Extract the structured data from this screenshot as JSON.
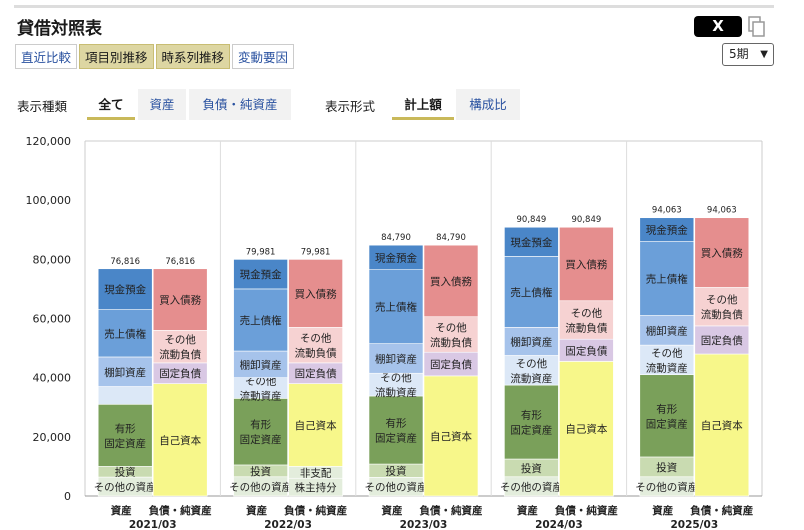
{
  "header": {
    "title": "貸借対照表",
    "share_label": "X"
  },
  "tabs": [
    {
      "label": "直近比較",
      "active": false
    },
    {
      "label": "項目別推移",
      "active": true
    },
    {
      "label": "時系列推移",
      "active": true
    },
    {
      "label": "変動要因",
      "active": false
    }
  ],
  "period_select": {
    "value": "5期"
  },
  "filters": {
    "type_label": "表示種類",
    "type_options": [
      {
        "label": "全て",
        "active": true
      },
      {
        "label": "資産",
        "active": false
      },
      {
        "label": "負債・純資産",
        "active": false
      }
    ],
    "format_label": "表示形式",
    "format_options": [
      {
        "label": "計上額",
        "active": true
      },
      {
        "label": "構成比",
        "active": false
      }
    ]
  },
  "chart_data": {
    "type": "bar",
    "stacked": true,
    "ylim": [
      0,
      120000
    ],
    "yticks": [
      0,
      20000,
      40000,
      60000,
      80000,
      100000,
      120000
    ],
    "ytick_labels": [
      "0",
      "20,000",
      "40,000",
      "60,000",
      "80,000",
      "100,000",
      "120,000"
    ],
    "grid": "vertical-between-years",
    "colors": {
      "cash": "#4a86c8",
      "receivables": "#6b9fd9",
      "inventory": "#a6c3eb",
      "other_current": "#dce8f7",
      "fixed": "#7aa05a",
      "investment": "#c9dbb1",
      "other_asset": "#e3eddc",
      "payables": "#e58e8e",
      "other_cur_liab": "#f6d2d2",
      "fixed_liab": "#d9c8e4",
      "equity": "#f7f78a"
    },
    "categories": [
      "2021/03",
      "2022/03",
      "2023/03",
      "2024/03",
      "2025/03"
    ],
    "bar_labels": [
      "資産",
      "負債・純資産"
    ],
    "periods": [
      {
        "year": "2021/03",
        "asset_total_label": "76,816",
        "liab_total_label": "76,816",
        "assets": [
          {
            "key": "other_asset",
            "value": 6400,
            "label": "その他の資産"
          },
          {
            "key": "investment",
            "value": 3600,
            "label": "投資"
          },
          {
            "key": "fixed",
            "value": 21000,
            "label": "有形\n固定資産"
          },
          {
            "key": "other_current",
            "value": 6000,
            "label": ""
          },
          {
            "key": "inventory",
            "value": 10000,
            "label": "棚卸資産"
          },
          {
            "key": "receivables",
            "value": 16000,
            "label": "売上債権"
          },
          {
            "key": "cash",
            "value": 13816,
            "label": "現金預金"
          }
        ],
        "liabilities": [
          {
            "key": "equity",
            "value": 38000,
            "label": "自己資本"
          },
          {
            "key": "fixed_liab",
            "value": 7000,
            "label": "固定負債"
          },
          {
            "key": "other_cur_liab",
            "value": 11000,
            "label": "その他\n流動負債"
          },
          {
            "key": "payables",
            "value": 20816,
            "label": "買入債務"
          }
        ]
      },
      {
        "year": "2022/03",
        "asset_total_label": "79,981",
        "liab_total_label": "79,981",
        "assets": [
          {
            "key": "other_asset",
            "value": 6500,
            "label": "その他の資産"
          },
          {
            "key": "investment",
            "value": 4000,
            "label": "投資"
          },
          {
            "key": "fixed",
            "value": 22500,
            "label": "有形\n固定資産"
          },
          {
            "key": "other_current",
            "value": 7000,
            "label": "その他\n流動資産"
          },
          {
            "key": "inventory",
            "value": 9000,
            "label": "棚卸資産"
          },
          {
            "key": "receivables",
            "value": 21000,
            "label": "売上債権"
          },
          {
            "key": "cash",
            "value": 9981,
            "label": "現金預金"
          }
        ],
        "liabilities": [
          {
            "key": "other_asset",
            "value": 6000,
            "label": "株主持分"
          },
          {
            "key": "other_asset",
            "value": 4000,
            "label": "非支配"
          },
          {
            "key": "equity",
            "value": 28000,
            "label": "自己資本"
          },
          {
            "key": "fixed_liab",
            "value": 7000,
            "label": "固定負債"
          },
          {
            "key": "other_cur_liab",
            "value": 12000,
            "label": "その他\n流動負債"
          },
          {
            "key": "payables",
            "value": 22981,
            "label": "買入債務"
          }
        ]
      },
      {
        "year": "2023/03",
        "asset_total_label": "84,790",
        "liab_total_label": "84,790",
        "assets": [
          {
            "key": "other_asset",
            "value": 6300,
            "label": "その他の資産"
          },
          {
            "key": "investment",
            "value": 4500,
            "label": "投資"
          },
          {
            "key": "fixed",
            "value": 23000,
            "label": "有形\n固定資産"
          },
          {
            "key": "other_current",
            "value": 7700,
            "label": "その他\n流動資産"
          },
          {
            "key": "inventory",
            "value": 10000,
            "label": "棚卸資産"
          },
          {
            "key": "receivables",
            "value": 25000,
            "label": "売上債権"
          },
          {
            "key": "cash",
            "value": 8290,
            "label": "現金預金"
          }
        ],
        "liabilities": [
          {
            "key": "equity",
            "value": 40600,
            "label": "自己資本"
          },
          {
            "key": "fixed_liab",
            "value": 8000,
            "label": "固定負債"
          },
          {
            "key": "other_cur_liab",
            "value": 12000,
            "label": "その他\n流動負債"
          },
          {
            "key": "payables",
            "value": 24190,
            "label": "買入債務"
          }
        ]
      },
      {
        "year": "2024/03",
        "asset_total_label": "90,849",
        "liab_total_label": "90,849",
        "assets": [
          {
            "key": "other_asset",
            "value": 6500,
            "label": "その他の資産"
          },
          {
            "key": "investment",
            "value": 6000,
            "label": "投資"
          },
          {
            "key": "fixed",
            "value": 25000,
            "label": "有形\n固定資産"
          },
          {
            "key": "other_current",
            "value": 10000,
            "label": "その他\n流動資産"
          },
          {
            "key": "inventory",
            "value": 9500,
            "label": "棚卸資産"
          },
          {
            "key": "receivables",
            "value": 24000,
            "label": "売上債権"
          },
          {
            "key": "cash",
            "value": 9849,
            "label": "現金預金"
          }
        ],
        "liabilities": [
          {
            "key": "equity",
            "value": 45500,
            "label": "自己資本"
          },
          {
            "key": "fixed_liab",
            "value": 7500,
            "label": "固定負債"
          },
          {
            "key": "other_cur_liab",
            "value": 13000,
            "label": "その他\n流動負債"
          },
          {
            "key": "payables",
            "value": 24849,
            "label": "買入債務"
          }
        ]
      },
      {
        "year": "2025/03",
        "asset_total_label": "94,063",
        "liab_total_label": "94,063",
        "assets": [
          {
            "key": "other_asset",
            "value": 6500,
            "label": "その他の資産"
          },
          {
            "key": "investment",
            "value": 6700,
            "label": "投資"
          },
          {
            "key": "fixed",
            "value": 27800,
            "label": "有形\n固定資産"
          },
          {
            "key": "other_current",
            "value": 10000,
            "label": "その他\n流動資産"
          },
          {
            "key": "inventory",
            "value": 10000,
            "label": "棚卸資産"
          },
          {
            "key": "receivables",
            "value": 25000,
            "label": "売上債権"
          },
          {
            "key": "cash",
            "value": 8063,
            "label": "現金預金"
          }
        ],
        "liabilities": [
          {
            "key": "equity",
            "value": 48000,
            "label": "自己資本"
          },
          {
            "key": "fixed_liab",
            "value": 9500,
            "label": "固定負債"
          },
          {
            "key": "other_cur_liab",
            "value": 13000,
            "label": "その他\n流動負債"
          },
          {
            "key": "payables",
            "value": 23563,
            "label": "買入債務"
          }
        ]
      }
    ]
  }
}
